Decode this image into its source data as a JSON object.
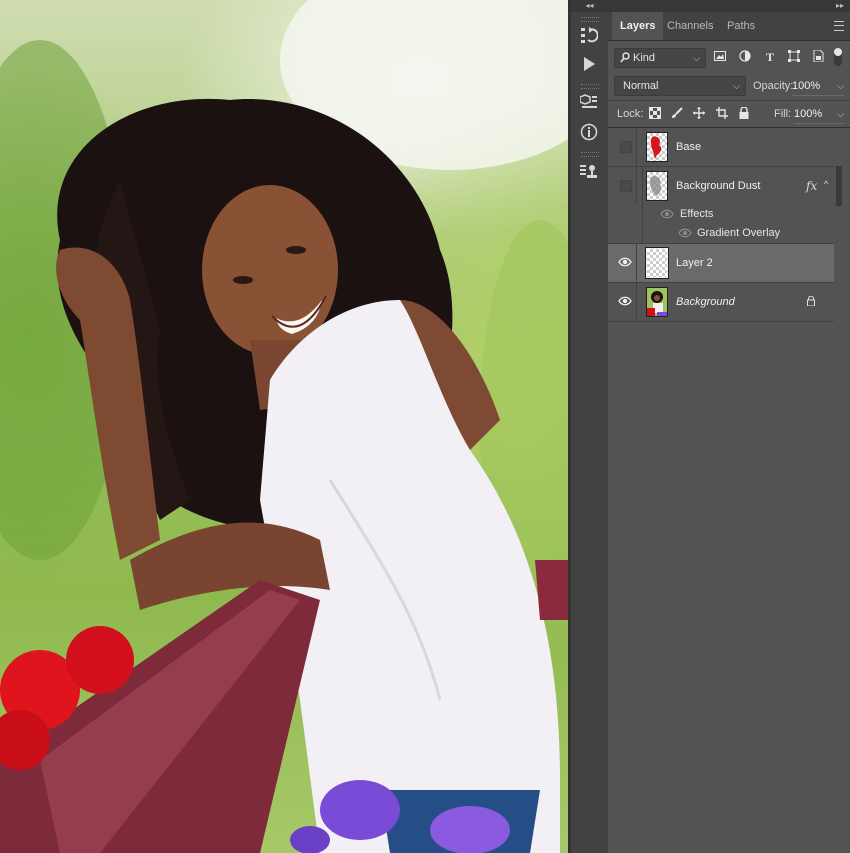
{
  "panel": {
    "collapse_left": "◂◂",
    "collapse_right": "▸▸",
    "tabs": [
      {
        "label": "Layers",
        "active": true
      },
      {
        "label": "Channels",
        "active": false
      },
      {
        "label": "Paths",
        "active": false
      }
    ],
    "filter": {
      "kind_label": "Kind",
      "icons": [
        "image-filter-icon",
        "adjustment-filter-icon",
        "type-filter-icon",
        "shape-filter-icon",
        "smart-object-filter-icon"
      ]
    },
    "blend_mode": "Normal",
    "opacity_label": "Opacity:",
    "opacity_value": "100%",
    "lock_label": "Lock:",
    "fill_label": "Fill:",
    "fill_value": "100%",
    "layers": [
      {
        "name": "Base",
        "visible": false,
        "selected": false
      },
      {
        "name": "Background Dust",
        "visible": false,
        "selected": false,
        "fx": "fx",
        "effects_label": "Effects",
        "effect_name": "Gradient Overlay"
      },
      {
        "name": "Layer 2",
        "visible": true,
        "selected": true
      },
      {
        "name": "Background",
        "visible": true,
        "selected": false,
        "locked": true,
        "italic": true
      }
    ]
  },
  "colors": {
    "panel_bg": "#535353",
    "selected_layer": "#6a6a6a",
    "toolstrip_bg": "#424242"
  }
}
